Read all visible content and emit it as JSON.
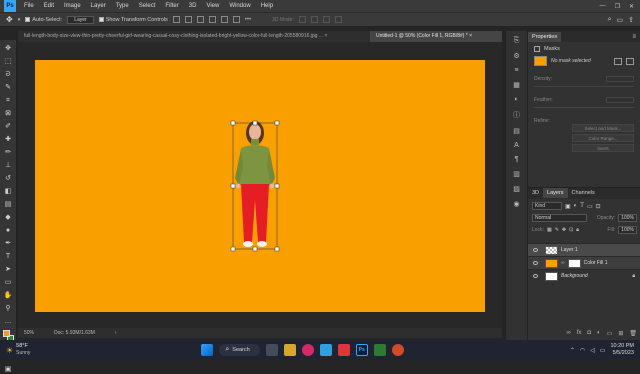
{
  "app": {
    "logo": "Ps"
  },
  "menu": [
    "File",
    "Edit",
    "Image",
    "Layer",
    "Type",
    "Select",
    "Filter",
    "3D",
    "View",
    "Window",
    "Help"
  ],
  "options": {
    "auto_select": "Auto-Select:",
    "auto_select_value": "Layer",
    "transform": "Show Transform Controls",
    "mode3d": "3D Mode:"
  },
  "tabs": [
    {
      "label": "full-length-body-size-view-thin-pretty-cheerful-girl-wearing-casual-cosy-clothing-isolated-bright-yellow-color-full-length-205580916.jpg ...  ×"
    },
    {
      "label": "Untitled-1 @ 50% (Color Fill 1, RGB/8#) *  ×"
    }
  ],
  "status": {
    "zoom": "50%",
    "doc": "Doc: 5.93M/1.63M"
  },
  "properties": {
    "title": "Properties",
    "section": "Masks",
    "no_mask": "No mask selected",
    "density": "Density:",
    "feather": "Feather:",
    "refine": "Refine:",
    "select_mask": "Select and Mask...",
    "color_range": "Color Range...",
    "invert": "Invert"
  },
  "layers_panel": {
    "tabs": [
      "3D",
      "Layers",
      "Channels"
    ],
    "kind": "Kind",
    "blend": "Normal",
    "opacity_label": "Opacity:",
    "opacity": "100%",
    "lock_label": "Lock:",
    "fill_label": "Fill:",
    "fill": "100%",
    "layers": [
      {
        "name": "Layer 1"
      },
      {
        "name": "Color Fill 1"
      },
      {
        "name": "Background"
      }
    ]
  },
  "taskbar": {
    "temp": "58°F",
    "weather": "Sunny",
    "search": "Search",
    "time": "10:20 PM",
    "date": "5/5/2023"
  },
  "colors": {
    "canvas": "#fa9f00",
    "fg": "#fa9f00",
    "bg": "#2e8b2e"
  }
}
